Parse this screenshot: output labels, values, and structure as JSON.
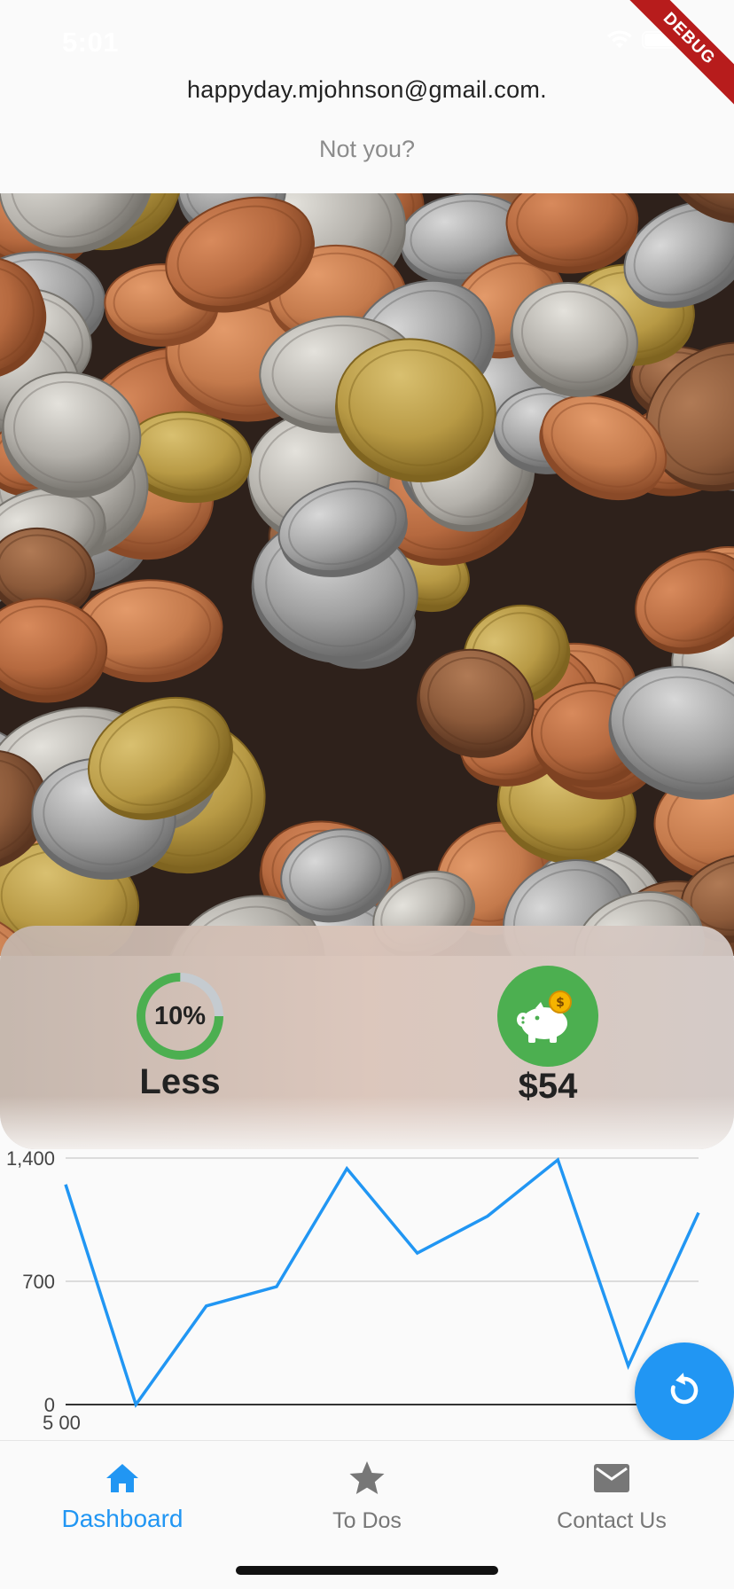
{
  "status_bar": {
    "time": "5:01",
    "icons": [
      "wifi-icon",
      "battery-icon"
    ],
    "debug_banner": "DEBUG"
  },
  "account": {
    "email": "happyday.mjohnson@gmail.com.",
    "not_you_link": "Not you?"
  },
  "hero": {
    "image_subject": "pile of coins",
    "icon": "coins-photo"
  },
  "stats": {
    "percent_change": {
      "value_text": "10%",
      "progress": 0.1,
      "label": "Less",
      "ring_color": "#4caf50",
      "track_color": "#c5cbd0"
    },
    "savings": {
      "icon": "piggy-bank-icon",
      "value_text": "$54",
      "circle_color": "#4caf50"
    }
  },
  "chart_data": {
    "type": "line",
    "y_ticks": [
      "1,400",
      "700",
      "0"
    ],
    "x_axis_label_text": "5 00",
    "ylim": [
      0,
      1400
    ],
    "grid": true,
    "series": [
      {
        "color": "#2196f3",
        "values": [
          1250,
          0,
          560,
          670,
          1340,
          860,
          1070,
          1390,
          220,
          1090
        ]
      }
    ]
  },
  "fab": {
    "icon": "refresh-icon",
    "color": "#2196f3"
  },
  "bottom_nav": {
    "items": [
      {
        "label": "Dashboard",
        "icon": "home-icon",
        "active": true
      },
      {
        "label": "To Dos",
        "icon": "star-icon",
        "active": false
      },
      {
        "label": "Contact Us",
        "icon": "mail-icon",
        "active": false
      }
    ],
    "active_color": "#2196f3",
    "inactive_color": "#777777"
  }
}
